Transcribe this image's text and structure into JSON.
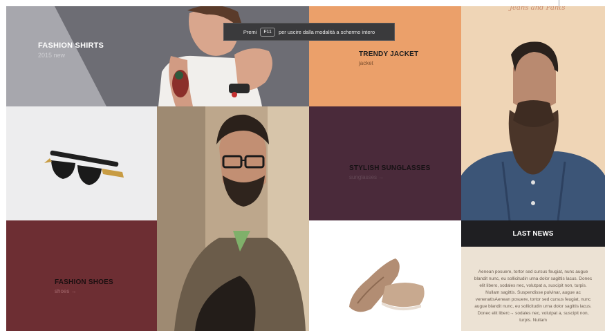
{
  "osd": {
    "prefix": "Premi",
    "key": "F11",
    "suffix": "per uscire dalla modalità a schermo intero"
  },
  "tiles": {
    "fashion_shirts": {
      "title": "FASHION SHIRTS",
      "subtitle": "2015 new"
    },
    "trendy_jacket": {
      "title": "TRENDY JACKET",
      "subtitle": "jacket"
    },
    "stylish_sunglasses": {
      "title": "STYLISH SUNGLASSES",
      "subtitle": "sunglasses →"
    },
    "fashion_shoes": {
      "title": "FASHION SHOES",
      "subtitle": "shoes →"
    },
    "jeans_pants": {
      "script_label": "Jeans and Pants"
    }
  },
  "news": {
    "heading": "LAST NEWS",
    "body": "Aenean posuere, tortor sed cursus feugiat, nunc augue blandit nunc, eu sollicitudin urna dolor sagittis lacus. Donec elit libero, sodales nec, volutpat a, suscipit non, turpis. Nullam sagittis. Suspendisse pulvinar, augue ac venenatisAenean posuere, tortor sed cursus feugiat, nunc augue blandit nunc, eu sollicitudin urna dolor sagittis lacus. Donec elit liberc→ sodales nec, volutpat a, suscipit non, turpis. Nullam"
  },
  "colors": {
    "shirts_bg": "#8f8f95",
    "jacket_bg": "#eba06a",
    "sunglasses_bg": "#4a2a3a",
    "shoes_bg": "#6d2e33",
    "product_bg": "#ededee",
    "beard_bg": "#efd5b6",
    "news_bg": "#ece2d4",
    "bar_bg": "#1f1f22"
  }
}
